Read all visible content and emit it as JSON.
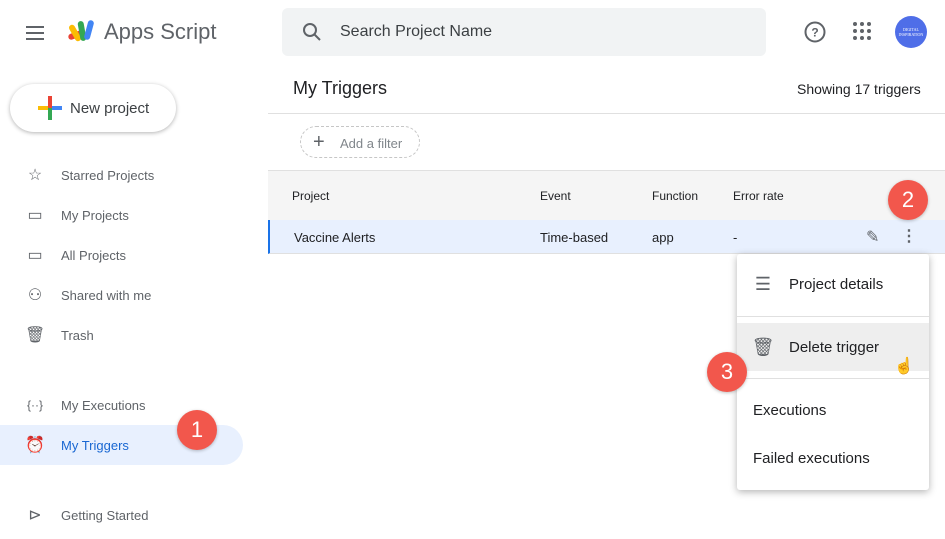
{
  "header": {
    "brand": "Apps Script",
    "search_placeholder": "Search Project Name",
    "avatar_text": "DIGITAL INSPIRATION"
  },
  "sidebar": {
    "new_project": "New project",
    "items": [
      {
        "label": "Starred Projects",
        "icon": "star-icon"
      },
      {
        "label": "My Projects",
        "icon": "folder-icon"
      },
      {
        "label": "All Projects",
        "icon": "folder-icon"
      },
      {
        "label": "Shared with me",
        "icon": "people-icon"
      },
      {
        "label": "Trash",
        "icon": "trash-icon"
      },
      {
        "label": "My Executions",
        "icon": "executions-icon"
      },
      {
        "label": "My Triggers",
        "icon": "alarm-icon",
        "active": true
      },
      {
        "label": "Getting Started",
        "icon": "play-circle-icon"
      }
    ]
  },
  "main": {
    "title": "My Triggers",
    "count": "Showing 17 triggers",
    "filter": "Add a filter",
    "columns": [
      "Project",
      "Event",
      "Function",
      "Error rate"
    ],
    "rows": [
      {
        "project": "Vaccine Alerts",
        "event": "Time-based",
        "function": "app",
        "error_rate": "-"
      }
    ]
  },
  "menu": {
    "items": [
      "Project details",
      "Delete trigger",
      "Executions",
      "Failed executions"
    ]
  },
  "badges": [
    "1",
    "2",
    "3"
  ],
  "colors": {
    "accent": "#1a73e8",
    "badge": "#f2574c",
    "active_bg": "#e8f0fe"
  }
}
